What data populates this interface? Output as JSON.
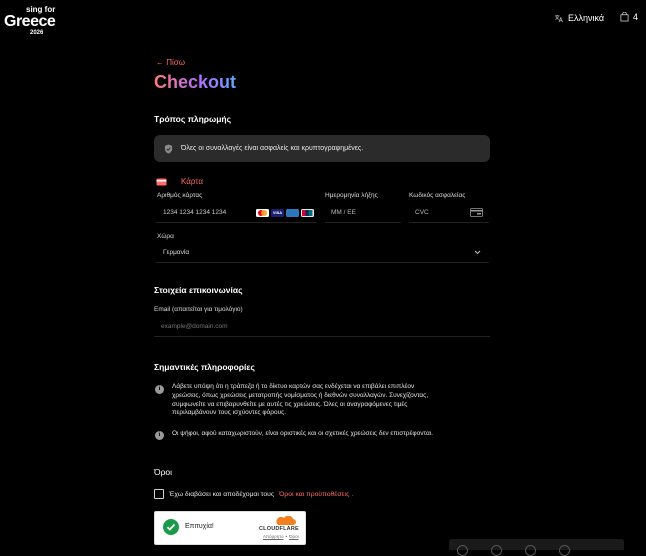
{
  "header": {
    "logo": {
      "line1": "sing for",
      "line2": "Greece",
      "line3": "2026"
    },
    "language_label": "Ελληνικά",
    "cart_count": "4"
  },
  "nav": {
    "back_label": "← Πίσω"
  },
  "page": {
    "title": "Checkout"
  },
  "payment": {
    "heading": "Τρόπος πληρωμής",
    "secure_note": "Όλες οι συναλλαγές είναι ασφαλείς και κρυπτογραφημένες.",
    "card_tab_label": "Κάρτα",
    "card_number_label": "Αριθμός κάρτας",
    "card_number_placeholder": "1234 1234 1234 1234",
    "expiry_label": "Ημερομηνία λήξης",
    "expiry_placeholder": "MM / ΕΕ",
    "cvc_label": "Κωδικός ασφαλείας",
    "cvc_placeholder": "CVC",
    "country_label": "Χώρα",
    "country_value": "Γερμανία",
    "brands": [
      "mastercard",
      "VISA",
      "AMEX",
      "UnionPay"
    ]
  },
  "contact": {
    "heading": "Στοιχεία επικοινωνίας",
    "email_label": "Email (απαιτείται για τιμολόγιο)",
    "email_placeholder": "example@domain.com"
  },
  "important": {
    "heading": "Σημαντικές πληροφορίες",
    "item1_line1": "Λάβετε υπόψη ότι η τράπεζα ή το δίκτυο καρτών σας ενδέχεται να επιβάλει επιπλέον",
    "item1_line2": "χρεώσεις, όπως χρεώσεις μετατροπής νομίσματος ή διεθνών συναλλαγών. Συνεχίζοντας,",
    "item1_line3": "συμφωνείτε να επιβαρυνθείτε με αυτές τις χρεώσεις. Όλες οι αναγραφόμενες τιμές",
    "item1_line4": "περιλαμβάνουν τους ισχύοντες φόρους.",
    "item2": "Οι ψήφοι, αφού καταχωριστούν, είναι οριστικές και οι σχετικές χρεώσεις δεν επιστρέφονται."
  },
  "terms": {
    "heading": "Όροι",
    "checkbox_text": "Έχω διαβάσει και αποδέχομαι τους",
    "link_text": "Όροι και προϋποθέσεις",
    "suffix": "."
  },
  "captcha": {
    "status": "Επιτυχία!",
    "brand": "CLOUDFLARE",
    "privacy": "Απόρρητο",
    "separator": "•",
    "terms": "Όροι"
  },
  "colors": {
    "accent": "#ff6b6b",
    "background": "#000000",
    "panel": "#2b2b2b"
  }
}
